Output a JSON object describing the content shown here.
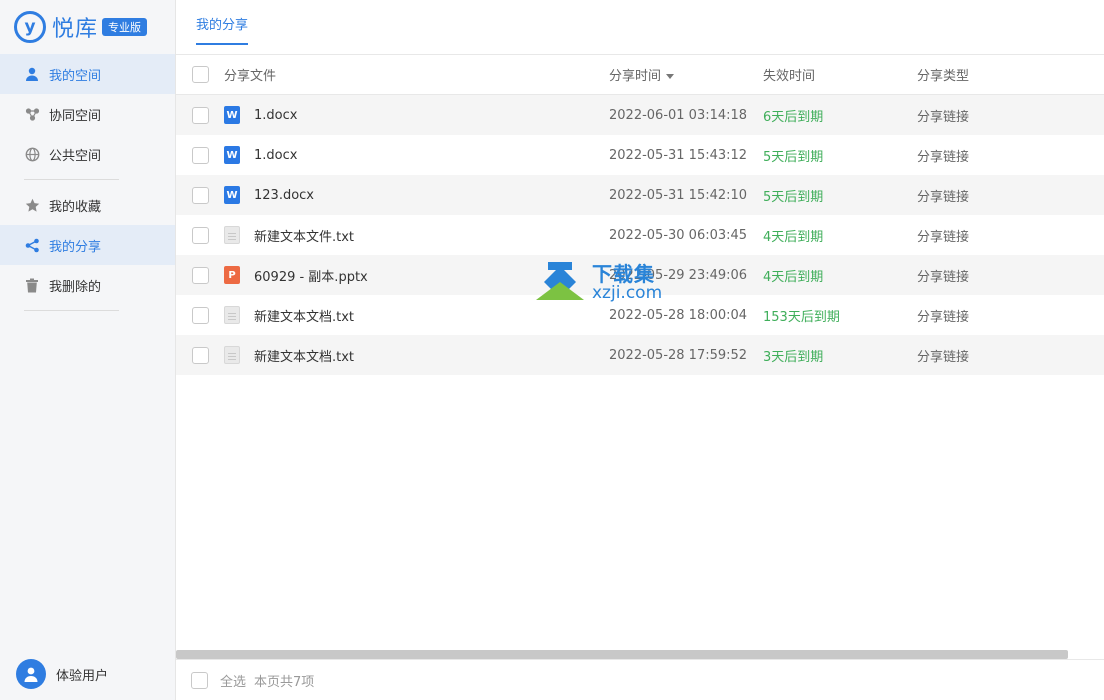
{
  "brand": {
    "logo_letter": "y",
    "name": "悦库",
    "badge": "专业版"
  },
  "sidebar": {
    "items": [
      {
        "label": "我的空间",
        "icon": "user-icon",
        "active": true
      },
      {
        "label": "协同空间",
        "icon": "collaborate-icon",
        "active": false
      },
      {
        "label": "公共空间",
        "icon": "globe-icon",
        "active": false
      },
      {
        "label": "我的收藏",
        "icon": "star-icon",
        "active": false
      },
      {
        "label": "我的分享",
        "icon": "share-icon",
        "active": true
      },
      {
        "label": "我删除的",
        "icon": "trash-icon",
        "active": false
      }
    ],
    "user": {
      "name": "体验用户",
      "icon": "user-avatar-icon"
    }
  },
  "main": {
    "tab": "我的分享",
    "columns": {
      "name": "分享文件",
      "time": "分享时间",
      "expiry": "失效时间",
      "type": "分享类型"
    },
    "rows": [
      {
        "file": "1.docx",
        "kind": "word",
        "time": "2022-06-01 03:14:18",
        "expiry": "6天后到期",
        "type": "分享链接"
      },
      {
        "file": "1.docx",
        "kind": "word",
        "time": "2022-05-31 15:43:12",
        "expiry": "5天后到期",
        "type": "分享链接"
      },
      {
        "file": "123.docx",
        "kind": "word",
        "time": "2022-05-31 15:42:10",
        "expiry": "5天后到期",
        "type": "分享链接"
      },
      {
        "file": "新建文本文件.txt",
        "kind": "txt",
        "time": "2022-05-30 06:03:45",
        "expiry": "4天后到期",
        "type": "分享链接"
      },
      {
        "file": "60929 - 副本.pptx",
        "kind": "ppt",
        "time": "2022-05-29 23:49:06",
        "expiry": "4天后到期",
        "type": "分享链接"
      },
      {
        "file": "新建文本文档.txt",
        "kind": "txt",
        "time": "2022-05-28 18:00:04",
        "expiry": "153天后到期",
        "type": "分享链接"
      },
      {
        "file": "新建文本文档.txt",
        "kind": "txt",
        "time": "2022-05-28 17:59:52",
        "expiry": "3天后到期",
        "type": "分享链接"
      }
    ],
    "footer": {
      "select_all": "全选",
      "count": "本页共7项"
    }
  },
  "watermark": {
    "top": "下载集",
    "bottom": "xzji.com"
  },
  "colors": {
    "accent": "#2f7de1",
    "expiry_green": "#3fae5a",
    "watermark_blue": "#2a84d8",
    "watermark_green": "#7cc242"
  }
}
